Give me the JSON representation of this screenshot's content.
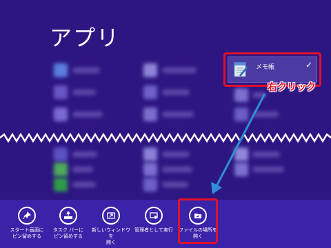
{
  "header": {
    "title": "アプリ"
  },
  "selected_app": {
    "label": "メモ帳",
    "checked": true
  },
  "annotation": {
    "callout": "右クリック",
    "highlight_color": "#e0102a"
  },
  "app_bar": {
    "commands": [
      {
        "label": "スタート画面に\nピン留めする",
        "icon": "pin-icon"
      },
      {
        "label": "タスク バーに\nピン留めする",
        "icon": "taskbar-pin-icon"
      },
      {
        "label": "新しいウィンドウを\n開く",
        "icon": "new-window-icon"
      },
      {
        "label": "管理者として実行",
        "icon": "run-as-admin-icon"
      },
      {
        "label": "ファイルの場所を\n開く",
        "icon": "open-file-location-icon"
      }
    ]
  },
  "colors": {
    "background": "#2e1682",
    "app_bar": "#3a23a8",
    "arrow": "#2e8fd6"
  }
}
